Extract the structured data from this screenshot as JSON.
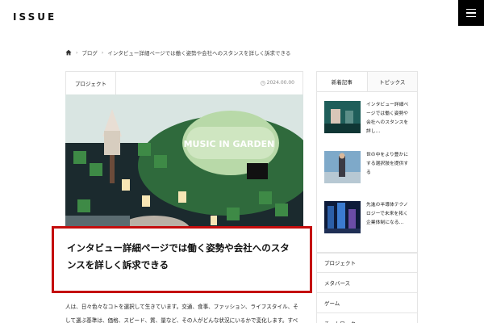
{
  "header": {
    "logo": "ISSUE",
    "menu_icon": "hamburger-icon"
  },
  "breadcrumb": {
    "home_icon": "home-icon",
    "items": [
      "ブログ",
      "インタビュー詳細ページでは働く姿勢や会社へのスタンスを詳しく訴求できる"
    ]
  },
  "article": {
    "category": "プロジェクト",
    "date": "2024.00.00",
    "date_icon": "clock-icon",
    "hero_sign": "MUSIC IN GARDEN",
    "title": "インタビュー詳細ページでは働く姿勢や会社へのスタンスを詳しく訴求できる",
    "body": "人は、日々色々なコトを選択して生きています。交通、食事、ファッション、ライフスタイル、そして選ぶ基準は、価格、スピード、質、量など、その人がどんな状況にいるかで変化します。すべ"
  },
  "sidebar": {
    "tabs": [
      "新着記事",
      "トピックス"
    ],
    "posts": [
      {
        "title": "インタビュー詳細ページでは働く姿勢や会社へのスタンスを詳し…"
      },
      {
        "title": "世の中をより豊かにする選択肢を提供する"
      },
      {
        "title": "先進の半導体テクノロジーで未来を拓く企業体制になる…"
      }
    ],
    "categories": [
      "プロジェクト",
      "メタバース",
      "ゲーム",
      "チームワーク"
    ]
  },
  "colors": {
    "accent_border": "#c40d0d",
    "menu_bg": "#000000"
  }
}
